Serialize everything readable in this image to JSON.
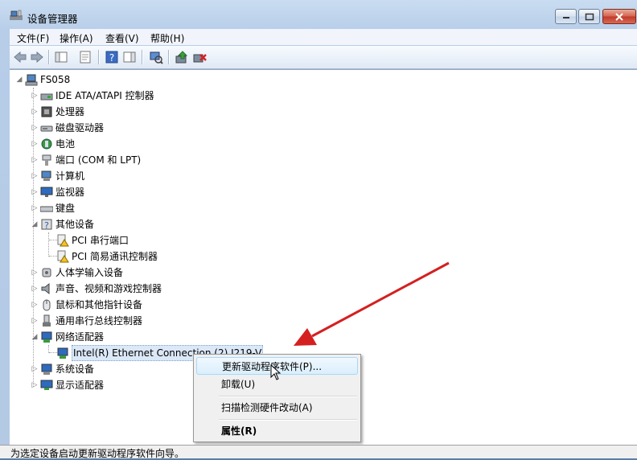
{
  "window": {
    "title": "设备管理器"
  },
  "menubar": [
    "文件(F)",
    "操作(A)",
    "查看(V)",
    "帮助(H)"
  ],
  "toolbar_icons": [
    "back-arrow-icon",
    "forward-arrow-icon",
    "show-hide-tree-icon",
    "properties-icon",
    "help-icon",
    "action-pane-icon",
    "scan-hardware-icon",
    "update-driver-icon",
    "disable-device-icon"
  ],
  "tree": {
    "root": "FS058",
    "categories": [
      "IDE ATA/ATAPI 控制器",
      "处理器",
      "磁盘驱动器",
      "电池",
      "端口 (COM 和 LPT)",
      "计算机",
      "监视器",
      "键盘",
      "其他设备",
      "PCI 串行端口",
      "PCI 简易通讯控制器",
      "人体学输入设备",
      "声音、视频和游戏控制器",
      "鼠标和其他指针设备",
      "通用串行总线控制器",
      "网络适配器",
      "Intel(R) Ethernet Connection (2) I219-V",
      "系统设备",
      "显示适配器"
    ]
  },
  "context_menu": {
    "update_driver": "更新驱动程序软件(P)...",
    "uninstall": "卸载(U)",
    "scan": "扫描检测硬件改动(A)",
    "properties": "属性(R)"
  },
  "status": "为选定设备启动更新驱动程序软件向导。",
  "colors": {
    "arrow": "#d42020",
    "selection": "#dbe8f7"
  }
}
